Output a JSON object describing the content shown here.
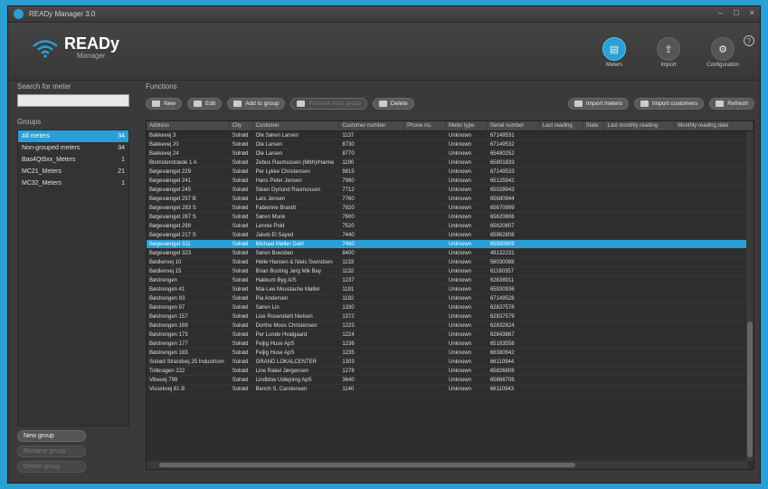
{
  "window": {
    "title": "READy Manager 3.0",
    "controls": [
      "–",
      "□",
      "×"
    ]
  },
  "logo": {
    "title": "READy",
    "subtitle": "Manager"
  },
  "nav": [
    {
      "label": "Meters",
      "icon": "meters-icon",
      "active": true
    },
    {
      "label": "Import",
      "icon": "import-icon",
      "active": false
    },
    {
      "label": "Configuration",
      "icon": "gear-icon",
      "active": false
    }
  ],
  "help_label": "?",
  "sidebar": {
    "search_label": "Search for meter",
    "search_value": "",
    "groups_label": "Groups",
    "groups": [
      {
        "name": "All meters",
        "count": "34",
        "selected": true
      },
      {
        "name": "Non-grouped meters",
        "count": "34",
        "selected": false
      },
      {
        "name": "Bas4Qt5xx_Meters",
        "count": "1",
        "selected": false
      },
      {
        "name": "MC21_Meters",
        "count": "21",
        "selected": false
      },
      {
        "name": "MC32_Meters",
        "count": "1",
        "selected": false
      }
    ],
    "buttons": [
      {
        "label": "New group",
        "enabled": true
      },
      {
        "label": "Rename group",
        "enabled": false
      },
      {
        "label": "Delete group",
        "enabled": false
      }
    ]
  },
  "main": {
    "functions_label": "Functions",
    "toolbar": [
      {
        "label": "New",
        "enabled": true
      },
      {
        "label": "Edit",
        "enabled": true
      },
      {
        "label": "Add to group",
        "enabled": true
      },
      {
        "label": "Remove from group",
        "enabled": false
      },
      {
        "label": "Delete",
        "enabled": true
      }
    ],
    "toolbar_right": [
      {
        "label": "Import meters"
      },
      {
        "label": "Import customers"
      },
      {
        "label": "Refresh"
      }
    ],
    "columns": [
      "Address",
      "City",
      "Customer",
      "Customer number",
      "Phone no.",
      "Meter type",
      "Serial number",
      "Last reading",
      "State",
      "Last monthly reading",
      "Monthly reading date"
    ],
    "rows": [
      [
        "Bakkevej 3",
        "Solrød",
        "Ole Søren Larsen",
        "1137",
        "",
        "Unknown",
        "67149531",
        "",
        "",
        "",
        ""
      ],
      [
        "Bakkevej 20",
        "Solrød",
        "Ole Larsen",
        "8730",
        "",
        "Unknown",
        "67149532",
        "",
        "",
        "",
        ""
      ],
      [
        "Bakkevej 24",
        "Solrød",
        "Ole Larsen",
        "8770",
        "",
        "Unknown",
        "65480252",
        "",
        "",
        "",
        ""
      ],
      [
        "Blomsterstræde 1 A",
        "Solrød",
        "Zebus Rasmussen (Mbh)/Hanne",
        "1190",
        "",
        "Unknown",
        "65801833",
        "",
        "",
        "",
        ""
      ],
      [
        "Bøgevænget 229",
        "Solrød",
        "Per Lykke Christensen",
        "9815",
        "",
        "Unknown",
        "67149533",
        "",
        "",
        "",
        ""
      ],
      [
        "Bøgevænget 241",
        "Solrød",
        "Hans Peter Jensen",
        "7980",
        "",
        "Unknown",
        "65125942",
        "",
        "",
        "",
        ""
      ],
      [
        "Bøgevænget 245",
        "Solrød",
        "Steen Dyrlund Rasmussen",
        "7712",
        "",
        "Unknown",
        "65028943",
        "",
        "",
        "",
        ""
      ],
      [
        "Bøgevænget 257 B",
        "Solrød",
        "Lars Jensen",
        "7760",
        "",
        "Unknown",
        "65680944",
        "",
        "",
        "",
        ""
      ],
      [
        "Bøgevænget 283 S",
        "Solrød",
        "Fabienne Brandt",
        "7920",
        "",
        "Unknown",
        "65670999",
        "",
        "",
        "",
        ""
      ],
      [
        "Bøgevænget 287 S",
        "Solrød",
        "Søren Munk",
        "7600",
        "",
        "Unknown",
        "65620806",
        "",
        "",
        "",
        ""
      ],
      [
        "Bøgevænget 299",
        "Solrød",
        "Lennie Pold",
        "7520",
        "",
        "Unknown",
        "65620807",
        "",
        "",
        "",
        ""
      ],
      [
        "Bøgevænget 217 S",
        "Solrød",
        "Jakob El Sayed",
        "7440",
        "",
        "Unknown",
        "65962808",
        "",
        "",
        "",
        ""
      ],
      [
        "Bøgevænget 311",
        "Solrød",
        "Michael Møller Dahl",
        "7460",
        "",
        "Unknown",
        "65900809",
        "",
        "",
        "",
        ""
      ],
      [
        "Bøgevænget 323",
        "Solrød",
        "Søren Boesben",
        "8400",
        "",
        "Unknown",
        "49132231",
        "",
        "",
        "",
        ""
      ],
      [
        "Bødkervej 10",
        "Solrød",
        "Helle Hansen & Niels Svendsen",
        "1133",
        "",
        "Unknown",
        "56030088",
        "",
        "",
        "",
        ""
      ],
      [
        "Bødkervej 15",
        "Solrød",
        "Brian Busting Jørg Mik Bay",
        "1132",
        "",
        "Unknown",
        "61180357",
        "",
        "",
        "",
        ""
      ],
      [
        "Bøstrengen",
        "Solrød",
        "Hakkum Byg A/S",
        "1237",
        "",
        "Unknown",
        "62838911",
        "",
        "",
        "",
        ""
      ],
      [
        "Bøstrengen 41",
        "Solrød",
        "Mai-Lee Moustache Møller",
        "1191",
        "",
        "Unknown",
        "65930936",
        "",
        "",
        "",
        ""
      ],
      [
        "Bøstrengen 93",
        "Solrød",
        "Pia Andersen",
        "1192",
        "",
        "Unknown",
        "67149528",
        "",
        "",
        "",
        ""
      ],
      [
        "Bøstrengen 97",
        "Solrød",
        "Søren Lin",
        "1330",
        "",
        "Unknown",
        "62837578",
        "",
        "",
        "",
        ""
      ],
      [
        "Bøstrengen 157",
        "Solrød",
        "Lise Rosendahl Nielsen",
        "1372",
        "",
        "Unknown",
        "62837579",
        "",
        "",
        "",
        ""
      ],
      [
        "Bøstrengen 169",
        "Solrød",
        "Dorthe Moos Christensen",
        "1223",
        "",
        "Unknown",
        "62832824",
        "",
        "",
        "",
        ""
      ],
      [
        "Bøstrengen 173",
        "Solrød",
        "Per Lunde Hvalgaard",
        "1224",
        "",
        "Unknown",
        "62843867",
        "",
        "",
        "",
        ""
      ],
      [
        "Bøstrengen 177",
        "Solrød",
        "Feljig Huse ApS",
        "1236",
        "",
        "Unknown",
        "65183558",
        "",
        "",
        "",
        ""
      ],
      [
        "Bøstrengen 183",
        "Solrød",
        "Feljig Huse ApS",
        "1235",
        "",
        "Unknown",
        "66380942",
        "",
        "",
        "",
        ""
      ],
      [
        "Solrød Strandvej 25 Industriom",
        "Solrød",
        "GRAND LOKALCENTER",
        "1303",
        "",
        "Unknown",
        "66110944",
        "",
        "",
        "",
        ""
      ],
      [
        "Tolleragen 222",
        "Solrød",
        "Line Rakel Jørgensen",
        "1278",
        "",
        "Unknown",
        "65826808",
        "",
        "",
        "",
        ""
      ],
      [
        "Vibevej 799",
        "Solrød",
        "Lindbloe Udlejning ApS",
        "3640",
        "",
        "Unknown",
        "65866708",
        "",
        "",
        "",
        ""
      ],
      [
        "Vissekvej 81 B",
        "Solrød",
        "Bench S. Carstensen",
        "1140",
        "",
        "Unknown",
        "66110943",
        "",
        "",
        "",
        ""
      ]
    ],
    "selected_row": 12
  }
}
